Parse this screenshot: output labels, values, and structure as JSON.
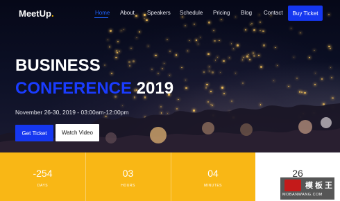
{
  "brand": {
    "name": "MeetUp",
    "dot": ".",
    "accent": "#f5b800",
    "primary": "#1537f0"
  },
  "nav": {
    "items": [
      "Home",
      "About",
      "Speakers",
      "Schedule",
      "Pricing",
      "Blog",
      "Contact"
    ],
    "active": "Home",
    "cta": "Buy Ticket"
  },
  "hero": {
    "title_line1": "BUSINESS",
    "title_line2_highlight": "CONFERENCE",
    "title_line2_rest": " 2019",
    "date": "November 26-30, 2019 - 03:00am-12:00pm",
    "primary_button": "Get Ticket",
    "secondary_button": "Watch Video"
  },
  "counters": [
    {
      "value": "-254",
      "label": "DAYS"
    },
    {
      "value": "03",
      "label": "HOURS"
    },
    {
      "value": "04",
      "label": "MINUTES"
    },
    {
      "value": "26",
      "label": ""
    }
  ],
  "watermark": {
    "text": "模板王",
    "url": "MOBANWANG.COM"
  }
}
